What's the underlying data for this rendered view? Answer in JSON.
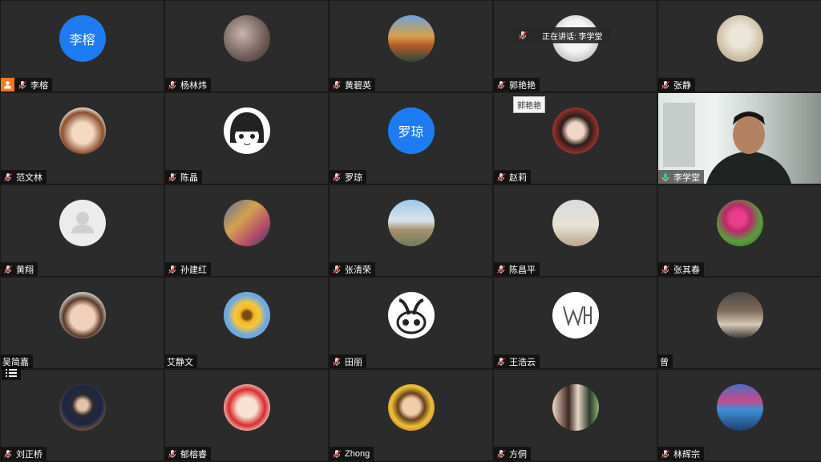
{
  "participants": [
    {
      "name": "李榕",
      "avatar_text": "李榕",
      "host": true
    },
    {
      "name": "杨林炜"
    },
    {
      "name": "黄碧英"
    },
    {
      "name": "郭艳艳"
    },
    {
      "name": "张静"
    },
    {
      "name": "范文林"
    },
    {
      "name": "陈晶"
    },
    {
      "name": "罗琼",
      "avatar_text": "罗琼"
    },
    {
      "name": "赵莉"
    },
    {
      "name": "李学堂",
      "video": true,
      "speaking": true
    },
    {
      "name": "黄翔"
    },
    {
      "name": "孙建红"
    },
    {
      "name": "张清荣"
    },
    {
      "name": "陈昌平"
    },
    {
      "name": "张其春"
    },
    {
      "name": "吴简嘉"
    },
    {
      "name": "艾静文"
    },
    {
      "name": "田丽"
    },
    {
      "name": "王浩云"
    },
    {
      "name": "曾"
    },
    {
      "name": "刘正桥"
    },
    {
      "name": "郁榕睿"
    },
    {
      "name": "Zhong"
    },
    {
      "name": "方侗"
    },
    {
      "name": "林辉宗"
    }
  ],
  "speaking_banner": "正在讲话: 李学堂",
  "tooltip": "郭艳艳",
  "colors": {
    "accent": "#1e7cf2",
    "host": "#f07d1a",
    "speaking": "#2bd46b"
  }
}
